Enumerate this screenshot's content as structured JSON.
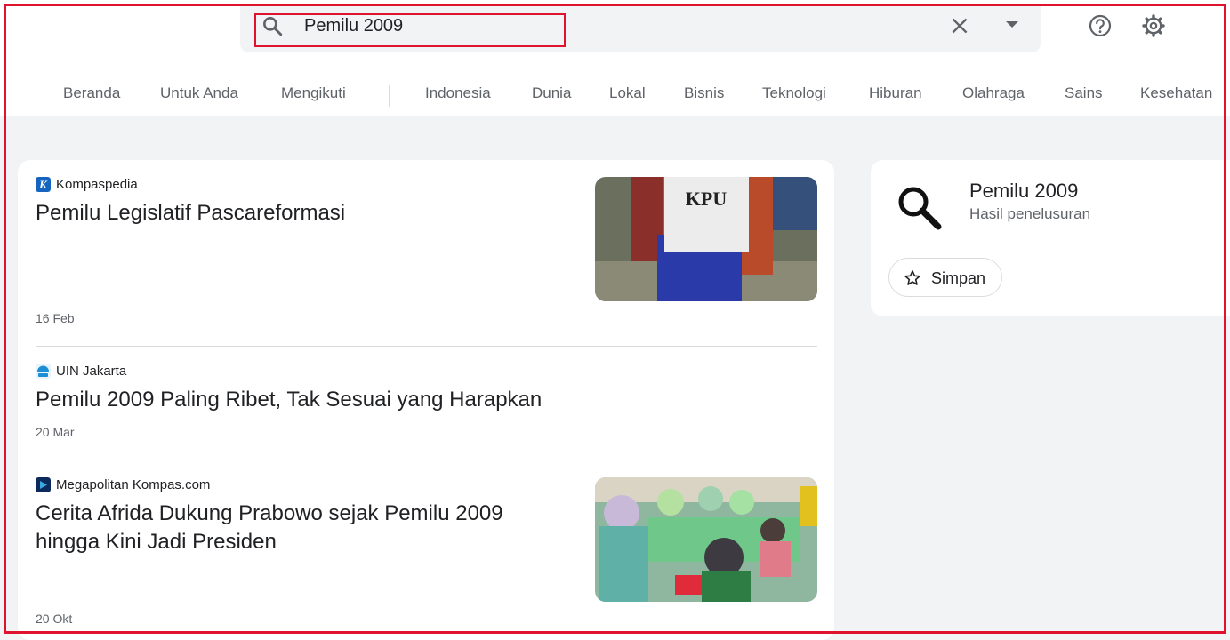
{
  "search": {
    "query": "Pemilu 2009"
  },
  "nav": {
    "personal": [
      "Beranda",
      "Untuk Anda",
      "Mengikuti"
    ],
    "topics": [
      "Indonesia",
      "Dunia",
      "Lokal",
      "Bisnis",
      "Teknologi",
      "Hiburan",
      "Olahraga",
      "Sains",
      "Kesehatan"
    ]
  },
  "articles": [
    {
      "source": "Kompaspedia",
      "title": "Pemilu Legislatif Pascareformasi",
      "date": "16 Feb",
      "thumb_text": "KPU"
    },
    {
      "source": "UIN Jakarta",
      "title": "Pemilu 2009 Paling Ribet, Tak Sesuai yang Harapkan",
      "date": "20 Mar"
    },
    {
      "source": "Megapolitan Kompas.com",
      "title_lines": [
        "Cerita Afrida Dukung Prabowo sejak Pemilu 2009",
        "hingga Kini Jadi Presiden"
      ],
      "date": "20 Okt"
    }
  ],
  "side": {
    "title": "Pemilu 2009",
    "subtitle": "Hasil penelusuran",
    "save_label": "Simpan"
  },
  "colors": {
    "highlight": "#e0132f",
    "background": "#f1f3f4"
  }
}
